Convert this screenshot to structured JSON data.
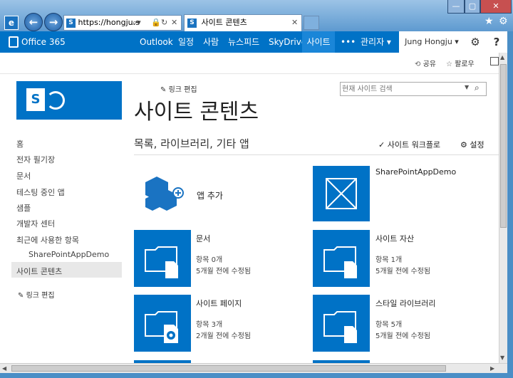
{
  "browser": {
    "address": "https://hongju.s",
    "tab_title": "사이트 콘텐츠"
  },
  "suite": {
    "brand": "Office 365",
    "nav": [
      "Outlook",
      "일정",
      "사람",
      "뉴스피드",
      "SkyDrive",
      "사이트",
      "•••",
      "관리자 ▾"
    ],
    "user": "Jung Hongju ▾"
  },
  "subbar": {
    "share": "공유",
    "follow": "팔로우"
  },
  "page": {
    "edit_links_top": "링크 편집",
    "title": "사이트 콘텐츠",
    "search_placeholder": "현재 사이트 검색",
    "section_title": "목록, 라이브러리, 기타 앱",
    "site_workflows": "사이트 워크플로",
    "settings": "설정"
  },
  "quicklaunch": {
    "items": [
      "홈",
      "전자 필기장",
      "문서",
      "테스팅 중인 앱",
      "샘플",
      "개발자 센터",
      "최근에 사용한 항목",
      "SharePointAppDemo",
      "사이트 콘텐츠"
    ],
    "edit_links": "링크 편집"
  },
  "tiles": {
    "add_app": "앱 추가",
    "app_demo": "SharePointAppDemo",
    "docs": {
      "name": "문서",
      "count": "항목 0개",
      "modified": "5개월 전에 수정됨"
    },
    "assets": {
      "name": "사이트 자산",
      "count": "항목 1개",
      "modified": "5개월 전에 수정됨"
    },
    "pages": {
      "name": "사이트 페이지",
      "count": "항목 3개",
      "modified": "2개월 전에 수정됨"
    },
    "style": {
      "name": "스타일 라이브러리",
      "count": "항목 5개",
      "modified": "5개월 전에 수정됨"
    }
  }
}
